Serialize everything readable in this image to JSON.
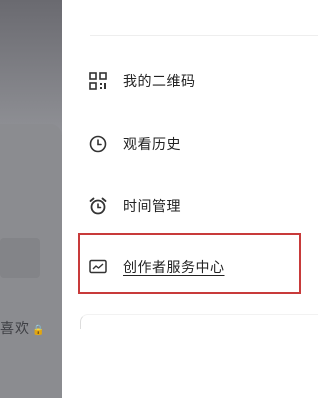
{
  "background_app": {
    "partial_text": "喜欢"
  },
  "drawer": {
    "items": [
      {
        "label": "我的二维码",
        "icon": "qr-code-icon"
      },
      {
        "label": "观看历史",
        "icon": "clock-icon"
      },
      {
        "label": "时间管理",
        "icon": "alarm-clock-icon"
      },
      {
        "label": "创作者服务中心",
        "icon": "trend-chart-icon"
      }
    ]
  },
  "colors": {
    "highlight_border": "#c83a3a",
    "dim_overlay": "#7a7b80",
    "text": "#222222"
  }
}
